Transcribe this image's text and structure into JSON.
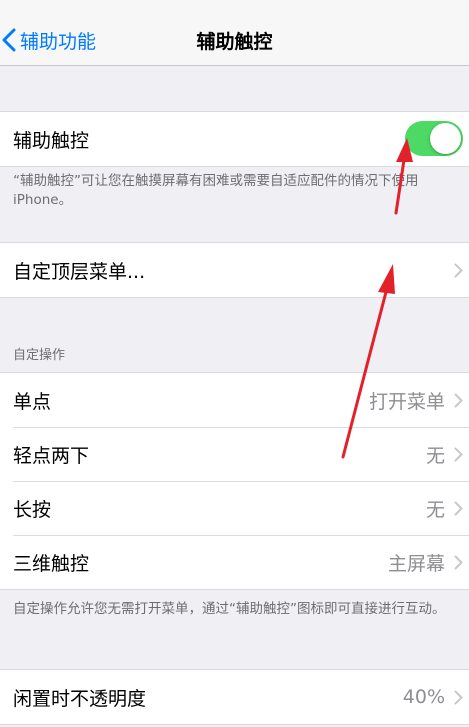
{
  "nav": {
    "back_label": "辅助功能",
    "title": "辅助触控"
  },
  "main_toggle": {
    "label": "辅助触控",
    "on": true
  },
  "toggle_footnote": "“辅助触控”可让您在触摸屏幕有困难或需要自适应配件的情况下使用 iPhone。",
  "customize_menu_label": "自定顶层菜单...",
  "custom_actions": {
    "header": "自定操作",
    "rows": [
      {
        "label": "单点",
        "value": "打开菜单"
      },
      {
        "label": "轻点两下",
        "value": "无"
      },
      {
        "label": "长按",
        "value": "无"
      },
      {
        "label": "三维触控",
        "value": "主屏幕"
      }
    ],
    "footnote": "自定操作允许您无需打开菜单，通过“辅助触控”图标即可直接进行互动。"
  },
  "idle_opacity": {
    "label": "闲置时不透明度",
    "value": "40%"
  },
  "colors": {
    "accent": "#007aff",
    "toggle_on": "#4cd964",
    "annotation_arrow": "#e3212b"
  },
  "icons": [
    "chevron-left-icon",
    "chevron-right-icon",
    "red-arrow-annotation"
  ]
}
